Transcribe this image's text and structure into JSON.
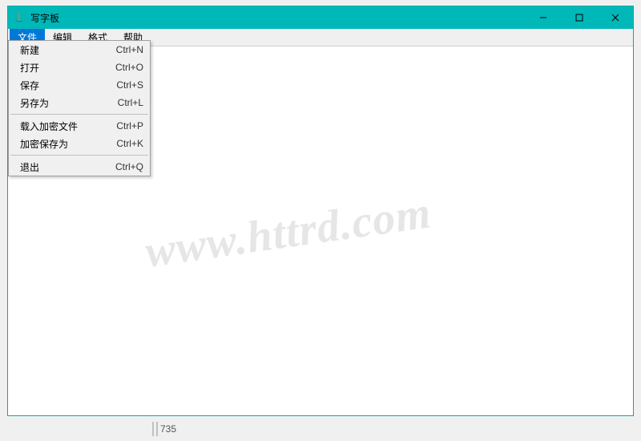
{
  "window": {
    "title": "写字板"
  },
  "menubar": {
    "items": [
      {
        "label": "文件",
        "active": true
      },
      {
        "label": "编辑",
        "active": false
      },
      {
        "label": "格式",
        "active": false
      },
      {
        "label": "帮助",
        "active": false
      }
    ]
  },
  "dropdown": {
    "groups": [
      [
        {
          "label": "新建",
          "shortcut": "Ctrl+N"
        },
        {
          "label": "打开",
          "shortcut": "Ctrl+O"
        },
        {
          "label": "保存",
          "shortcut": "Ctrl+S"
        },
        {
          "label": "另存为",
          "shortcut": "Ctrl+L"
        }
      ],
      [
        {
          "label": "载入加密文件",
          "shortcut": "Ctrl+P"
        },
        {
          "label": "加密保存为",
          "shortcut": "Ctrl+K"
        }
      ],
      [
        {
          "label": "退出",
          "shortcut": "Ctrl+Q"
        }
      ]
    ]
  },
  "watermark": "www.httrd.com",
  "status_fragment": "735"
}
